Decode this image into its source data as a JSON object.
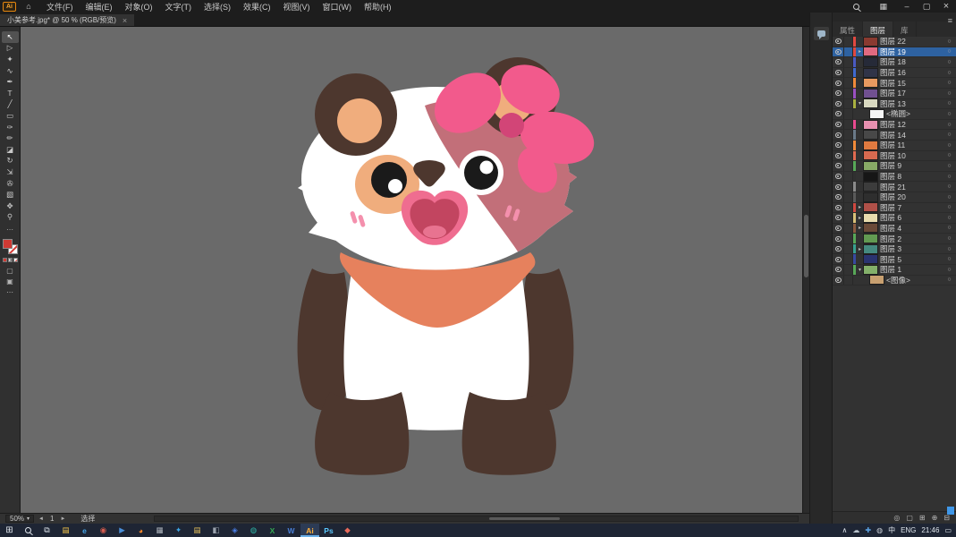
{
  "window": {
    "app_logo": "Ai",
    "home_icon": "⌂",
    "menu": [
      "文件(F)",
      "编辑(E)",
      "对象(O)",
      "文字(T)",
      "选择(S)",
      "效果(C)",
      "视图(V)",
      "窗口(W)",
      "帮助(H)"
    ],
    "workspace_icon": "▦",
    "minimize": "–",
    "maximize": "▢",
    "close": "×"
  },
  "tab": {
    "title": "小美参考.jpg* @ 50 % (RGB/预览)",
    "close": "×"
  },
  "tools": [
    {
      "name": "selection-tool",
      "glyph": "↖",
      "active": true
    },
    {
      "name": "direct-selection-tool",
      "glyph": "▷"
    },
    {
      "name": "magic-wand-tool",
      "glyph": "✦"
    },
    {
      "name": "lasso-tool",
      "glyph": "∿"
    },
    {
      "name": "pen-tool",
      "glyph": "✒"
    },
    {
      "name": "type-tool",
      "glyph": "T"
    },
    {
      "name": "line-segment-tool",
      "glyph": "╱"
    },
    {
      "name": "rectangle-tool",
      "glyph": "▭"
    },
    {
      "name": "paintbrush-tool",
      "glyph": "✑"
    },
    {
      "name": "pencil-tool",
      "glyph": "✏"
    },
    {
      "name": "eraser-tool",
      "glyph": "◪"
    },
    {
      "name": "rotate-tool",
      "glyph": "↻"
    },
    {
      "name": "scale-tool",
      "glyph": "⇲"
    },
    {
      "name": "eyedropper-tool",
      "glyph": "✇"
    },
    {
      "name": "gradient-tool",
      "glyph": "▧"
    },
    {
      "name": "hand-tool",
      "glyph": "✥"
    },
    {
      "name": "zoom-tool",
      "glyph": "⚲"
    }
  ],
  "toolbar_bottom": {
    "more": "⋯",
    "fill_color": "#cf3a34",
    "draw_mode": "▢",
    "screen_mode": "▣"
  },
  "artwork": {
    "palette": {
      "dark_brown": "#4d372e",
      "peach": "#f0ad7d",
      "white": "#ffffff",
      "mauve": "#c26f79",
      "bow_pink": "#f25a8c",
      "bow_center": "#d24577",
      "ink": "#1a1a1a",
      "mouth_outer": "#ef6d90",
      "mouth_inner": "#c24560",
      "tongue": "#e87390",
      "blush": "#f490ad",
      "bandana": "#e6815d"
    }
  },
  "layers_panel": {
    "tabs": [
      {
        "name": "properties-tab",
        "label": "属性"
      },
      {
        "name": "layers-tab",
        "label": "图层",
        "active": true
      },
      {
        "name": "libraries-tab",
        "label": "库"
      }
    ],
    "menu_icon": "≡",
    "target_glyph": "○",
    "rows": [
      {
        "name": "图层 22",
        "bar": "#e04840",
        "thumb": "#8a3a30"
      },
      {
        "name": "图层 19",
        "bar": "#e04840",
        "thumb": "#e06a80",
        "arrow": "▸",
        "selected": true
      },
      {
        "name": "图层 18",
        "bar": "#4a5ac0",
        "thumb": "#262a38"
      },
      {
        "name": "图层 16",
        "bar": "#3f6ad0",
        "thumb": "#303448"
      },
      {
        "name": "图层 15",
        "bar": "#f08a3a",
        "thumb": "#e89a60"
      },
      {
        "name": "图层 17",
        "bar": "#9a50c0",
        "thumb": "#705090"
      },
      {
        "name": "图层 13",
        "bar": "#a8b040",
        "thumb": "#d8d8c0",
        "arrow": "▾"
      },
      {
        "name": "<椭圆>",
        "thumb": "#f5f5f5",
        "child": true
      },
      {
        "name": "图层 12",
        "bar": "#e84a90",
        "thumb": "#e890b0"
      },
      {
        "name": "图层 14",
        "bar": "#6a7a88",
        "thumb": "#484848"
      },
      {
        "name": "图层 11",
        "bar": "#f08a3a",
        "thumb": "#e07a40"
      },
      {
        "name": "图层 10",
        "bar": "#e06a50",
        "thumb": "#d86a50"
      },
      {
        "name": "图层 9",
        "bar": "#58a858",
        "thumb": "#88aa66"
      },
      {
        "name": "图层 8",
        "bar": "#303030",
        "thumb": "#161616"
      },
      {
        "name": "图层 21",
        "bar": "#8a8a8a",
        "thumb": "#3c3c3c"
      },
      {
        "name": "图层 20",
        "bar": "#5a5a5a",
        "thumb": "#2e2e2e"
      },
      {
        "name": "图层 7",
        "bar": "#d04840",
        "thumb": "#b05048",
        "arrow": "▸"
      },
      {
        "name": "图层 6",
        "bar": "#d8c078",
        "thumb": "#e8dcae",
        "arrow": "▸"
      },
      {
        "name": "图层 4",
        "bar": "#8a5a40",
        "thumb": "#6a4a38",
        "arrow": "▸"
      },
      {
        "name": "图层 2",
        "bar": "#58a858",
        "thumb": "#629a52"
      },
      {
        "name": "图层 3",
        "bar": "#38a090",
        "thumb": "#458a80",
        "arrow": "▸"
      },
      {
        "name": "图层 5",
        "bar": "#3848a0",
        "thumb": "#2a3470"
      },
      {
        "name": "图层 1",
        "bar": "#58a858",
        "thumb": "#84b06a",
        "arrow": "▾"
      },
      {
        "name": "<图像>",
        "thumb": "#c8a070",
        "child": true
      }
    ],
    "footer_icons": [
      {
        "name": "locate-object-icon",
        "glyph": "◎"
      },
      {
        "name": "clip-mask-icon",
        "glyph": "▢"
      },
      {
        "name": "new-sublayer-icon",
        "glyph": "⊞"
      },
      {
        "name": "new-layer-icon",
        "glyph": "⊕"
      },
      {
        "name": "delete-layer-icon",
        "glyph": "⊟"
      }
    ]
  },
  "status": {
    "zoom": "50%",
    "caret": "▾",
    "prev": "◄",
    "artboard": "1",
    "next": "►",
    "mode": "选择"
  },
  "taskbar": {
    "start_glyph": "⊞",
    "taskview_glyph": "⧉",
    "apps": [
      {
        "name": "taskbar-file-explorer",
        "glyph": "▤",
        "color": "#f5c84c"
      },
      {
        "name": "taskbar-edge",
        "glyph": "e",
        "color": "#45a6e8"
      },
      {
        "name": "taskbar-chrome",
        "glyph": "◉",
        "color": "#d95d4e"
      },
      {
        "name": "taskbar-media-app",
        "glyph": "▶",
        "color": "#4a90d9"
      },
      {
        "name": "taskbar-firefox",
        "glyph": "◕",
        "color": "#ff8a2a"
      },
      {
        "name": "taskbar-app-6",
        "glyph": "▦",
        "color": "#aeb4bc"
      },
      {
        "name": "taskbar-app-7",
        "glyph": "✦",
        "color": "#3fa8e8"
      },
      {
        "name": "taskbar-folder",
        "glyph": "▤",
        "color": "#e8c25c"
      },
      {
        "name": "taskbar-app-9",
        "glyph": "◧",
        "color": "#9aa2ad"
      },
      {
        "name": "taskbar-photos",
        "glyph": "◈",
        "color": "#4a7fe8"
      },
      {
        "name": "taskbar-app-11",
        "glyph": "◍",
        "color": "#2fb8a8"
      },
      {
        "name": "taskbar-excel",
        "glyph": "X",
        "color": "#34a853"
      },
      {
        "name": "taskbar-word",
        "glyph": "W",
        "color": "#4a7fd6"
      },
      {
        "name": "taskbar-illustrator",
        "glyph": "Ai",
        "color": "#ffb13b",
        "active": true
      },
      {
        "name": "taskbar-photoshop",
        "glyph": "Ps",
        "color": "#5ac8ff"
      },
      {
        "name": "taskbar-app-16",
        "glyph": "◆",
        "color": "#e86a5a"
      }
    ],
    "tray": {
      "chevron": "∧",
      "icons": [
        {
          "name": "onedrive-icon",
          "glyph": "☁",
          "color": "#b9c3cc"
        },
        {
          "name": "security-icon",
          "glyph": "✚",
          "color": "#5aa0e0"
        },
        {
          "name": "update-icon",
          "glyph": "◍",
          "color": "#c8cdd4"
        }
      ],
      "ime": "中",
      "lang": "ENG",
      "time": "21:46",
      "notification_glyph": "▭"
    }
  }
}
